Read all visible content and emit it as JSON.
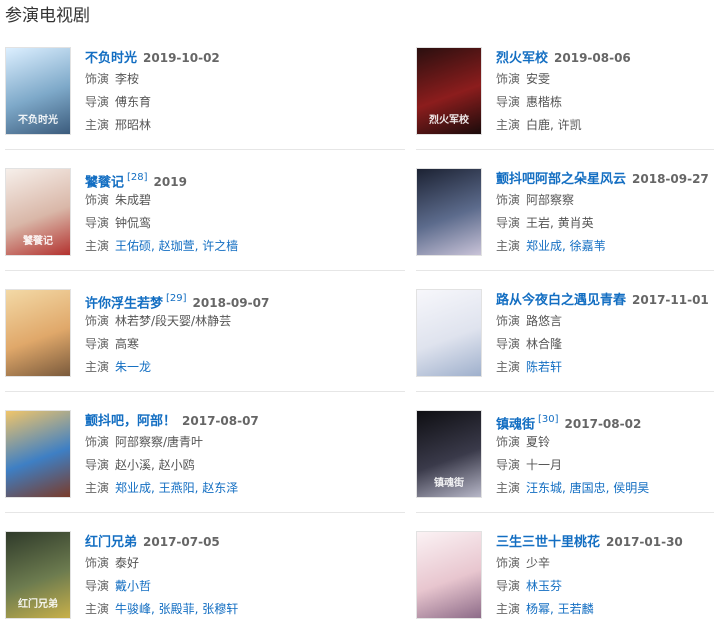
{
  "section": {
    "title": "参演电视剧"
  },
  "labels": {
    "role": "饰演",
    "director": "导演",
    "cast": "主演"
  },
  "dramas": [
    {
      "title": "不负时光",
      "ref": "",
      "date": "2019-10-02",
      "role": "李桉",
      "director": "傅东育",
      "cast": "邢昭林",
      "cast_linked": false,
      "colors": [
        "#dcefff",
        "#7ea9c9",
        "#3b5b7c"
      ],
      "poster_text": "不负时光"
    },
    {
      "title": "烈火军校",
      "ref": "",
      "date": "2019-08-06",
      "role": "安雯",
      "director": "惠楷栋",
      "cast": "白鹿, 许凯",
      "cast_linked": false,
      "colors": [
        "#2a0f0f",
        "#8c1d1d",
        "#1a0b0b"
      ],
      "poster_text": "烈火军校"
    },
    {
      "title": "饕餮记",
      "ref": "[28]",
      "date": "2019",
      "role": "朱成碧",
      "director": "钟侃鸾",
      "cast": "王佑硕, 赵珈萱, 许之樯",
      "cast_linked": true,
      "colors": [
        "#f6efea",
        "#d9b7a8",
        "#b3322f"
      ],
      "poster_text": "饕餮记"
    },
    {
      "title": "颤抖吧阿部之朵星风云",
      "ref": "",
      "date": "2018-09-27",
      "role": "阿部察察",
      "director": "王岩, 黄肖英",
      "cast": "郑业成, 徐嘉苇",
      "cast_linked": true,
      "colors": [
        "#1c2233",
        "#5c6b8c",
        "#c9c3d8"
      ],
      "poster_text": ""
    },
    {
      "title": "许你浮生若梦",
      "ref": "[29]",
      "date": "2018-09-07",
      "role": "林若梦/段天婴/林静芸",
      "director": "高寒",
      "cast": "朱一龙",
      "cast_linked": true,
      "colors": [
        "#f3d9a6",
        "#e0a86a",
        "#7a5a3c"
      ],
      "poster_text": ""
    },
    {
      "title": "路从今夜白之遇见青春",
      "ref": "",
      "date": "2017-11-01",
      "role": "路悠言",
      "director": "林合隆",
      "cast": "陈若轩",
      "cast_linked": true,
      "colors": [
        "#f7f7fb",
        "#dfe3ee",
        "#9fb0cc"
      ],
      "poster_text": ""
    },
    {
      "title": "颤抖吧，阿部！",
      "ref": "",
      "date": "2017-08-07",
      "role": "阿部察察/唐青叶",
      "director": "赵小溪, 赵小鸥",
      "cast": "郑业成, 王燕阳, 赵东泽",
      "cast_linked": true,
      "colors": [
        "#f0c56a",
        "#3e7fc4",
        "#7a3b2a"
      ],
      "poster_text": ""
    },
    {
      "title": "镇魂街",
      "ref": "[30]",
      "date": "2017-08-02",
      "role": "夏铃",
      "director": "十一月",
      "cast": "汪东城, 唐国忠, 侯明昊",
      "cast_linked": true,
      "colors": [
        "#0e0e12",
        "#3a3a4a",
        "#b7b7c8"
      ],
      "poster_text": "镇魂街"
    },
    {
      "title": "红门兄弟",
      "ref": "",
      "date": "2017-07-05",
      "role": "泰好",
      "director": "戴小哲",
      "cast": "牛骏峰, 张殿菲, 张穆轩",
      "cast_linked": true,
      "director_linked": true,
      "colors": [
        "#2f3a2a",
        "#6c7b4f",
        "#c8b04a"
      ],
      "poster_text": "红门兄弟"
    },
    {
      "title": "三生三世十里桃花",
      "ref": "",
      "date": "2017-01-30",
      "role": "少辛",
      "director": "林玉芬",
      "cast": "杨幂, 王若麟",
      "cast_linked": true,
      "director_linked": true,
      "colors": [
        "#fbf2f4",
        "#e8c6cf",
        "#8d6b88"
      ],
      "poster_text": ""
    }
  ]
}
